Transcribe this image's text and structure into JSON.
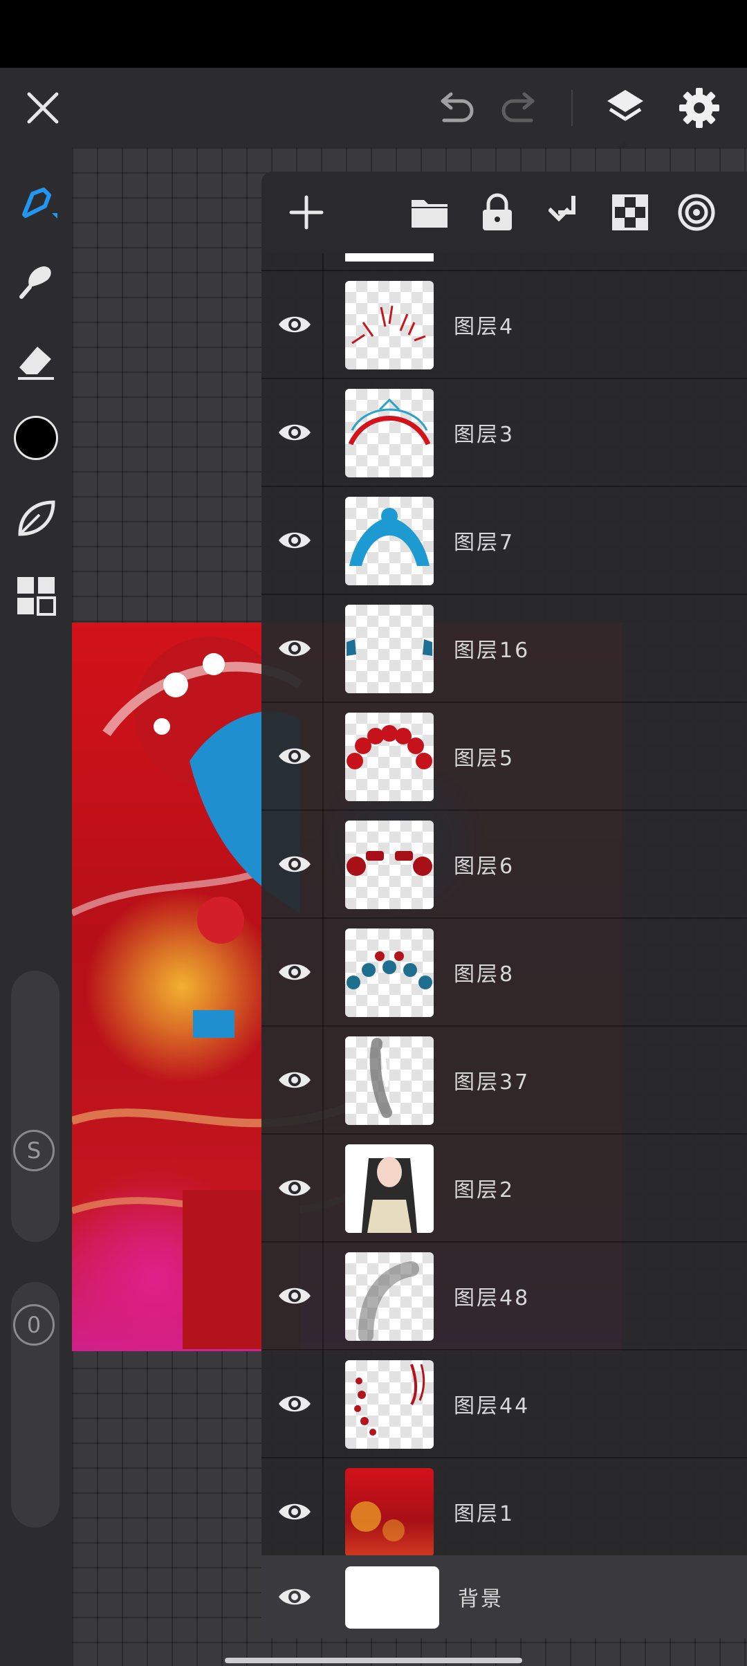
{
  "top_bar": {
    "close_icon": "close-icon",
    "undo_icon": "undo-icon",
    "redo_icon": "redo-icon",
    "layers_icon": "layers-icon",
    "settings_icon": "gear-icon"
  },
  "left_toolbar": {
    "tools": [
      "brush-icon",
      "smudge-icon",
      "eraser-icon",
      "color-swatch",
      "leaf-icon",
      "gallery-icon"
    ],
    "current_color": "#000000",
    "size_slider_label": "S",
    "opacity_slider_label": "0"
  },
  "layers_panel": {
    "toolbar": [
      "add-layer-icon",
      "folder-icon",
      "lock-icon",
      "merge-down-icon",
      "transparency-icon",
      "target-icon"
    ],
    "layers": [
      {
        "name": "图层4",
        "visible": true
      },
      {
        "name": "图层3",
        "visible": true
      },
      {
        "name": "图层7",
        "visible": true
      },
      {
        "name": "图层16",
        "visible": true
      },
      {
        "name": "图层5",
        "visible": true
      },
      {
        "name": "图层6",
        "visible": true
      },
      {
        "name": "图层8",
        "visible": true
      },
      {
        "name": "图层37",
        "visible": true
      },
      {
        "name": "图层2",
        "visible": true
      },
      {
        "name": "图层48",
        "visible": true
      },
      {
        "name": "图层44",
        "visible": true
      },
      {
        "name": "图层1",
        "visible": true
      },
      {
        "name": "背景",
        "visible": true
      }
    ]
  },
  "colors": {
    "accent": "#2196f3",
    "background": "#2b2b2d",
    "artwork_red": "#d3121a"
  }
}
